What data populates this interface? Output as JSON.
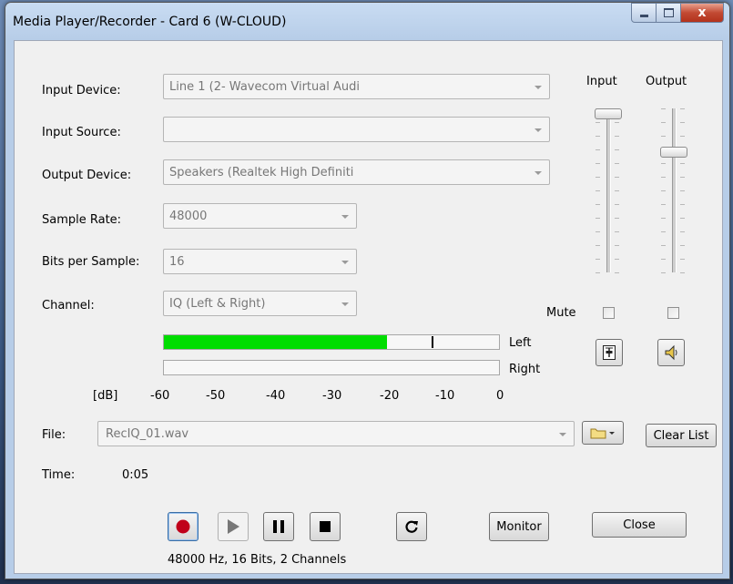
{
  "window": {
    "title": "Media Player/Recorder  - Card 6 (W-CLOUD)",
    "close_glyph": "x"
  },
  "form": {
    "input_device": {
      "label": "Input Device:",
      "value": "Line 1 (2- Wavecom Virtual Audi"
    },
    "input_source": {
      "label": "Input Source:",
      "value": ""
    },
    "output_device": {
      "label": "Output Device:",
      "value": "Speakers (Realtek High Definiti"
    },
    "sample_rate": {
      "label": "Sample Rate:",
      "value": "48000"
    },
    "bits_per_sample": {
      "label": "Bits per Sample:",
      "value": "16"
    },
    "channel": {
      "label": "Channel:",
      "value": "IQ (Left & Right)"
    }
  },
  "mixer": {
    "input_label": "Input",
    "output_label": "Output",
    "mute_label": "Mute",
    "input_mute_checked": false,
    "output_mute_checked": false,
    "input_level": 1.0,
    "output_level": 0.75,
    "input_icon": "input-level-icon",
    "output_icon": "speaker-icon"
  },
  "level_meter": {
    "left_label": "Left",
    "right_label": "Right",
    "unit_label": "[dB]",
    "scale": [
      "-60",
      "-50",
      "-40",
      "-30",
      "-20",
      "-10",
      "0"
    ],
    "left_level_db": -20,
    "left_peak_db": -12,
    "right_level_db": -60,
    "fill_color": "#00dd00"
  },
  "file": {
    "label": "File:",
    "value": "RecIQ_01.wav",
    "clear_list_label": "Clear List",
    "folder_icon": "folder-icon"
  },
  "time": {
    "label": "Time:",
    "value": "0:05"
  },
  "transport": {
    "record_icon": "record-icon",
    "play_icon": "play-icon",
    "pause_icon": "pause-icon",
    "stop_icon": "stop-icon",
    "loop_icon": "repeat-icon",
    "monitor_label": "Monitor",
    "close_label": "Close",
    "record_color": "#c0001a"
  },
  "status": "48000 Hz, 16 Bits, 2 Channels"
}
